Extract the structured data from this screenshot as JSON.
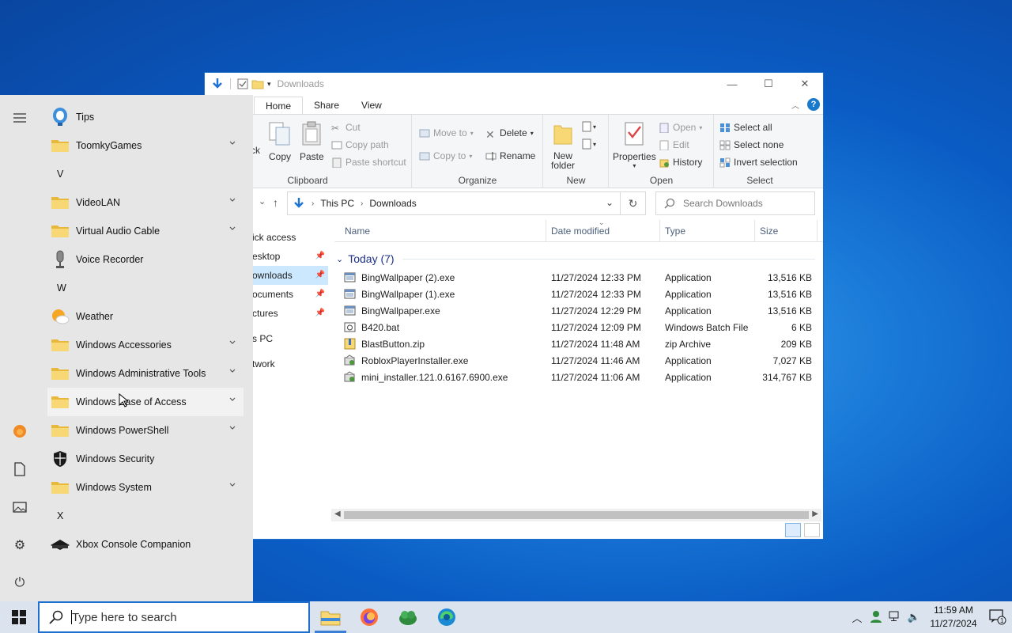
{
  "explorer": {
    "title": "Downloads",
    "tabs": [
      "Home",
      "Share",
      "View"
    ],
    "ribbon": {
      "clipboard": {
        "label": "Clipboard",
        "back_fragment": "ck",
        "copy": "Copy",
        "paste": "Paste",
        "cut": "Cut",
        "copy_path": "Copy path",
        "paste_shortcut": "Paste shortcut"
      },
      "organize": {
        "label": "Organize",
        "move_to": "Move to",
        "copy_to": "Copy to",
        "delete": "Delete",
        "rename": "Rename"
      },
      "new": {
        "label": "New",
        "new_folder": "New folder"
      },
      "open": {
        "label": "Open",
        "properties": "Properties",
        "open": "Open",
        "edit": "Edit",
        "history": "History"
      },
      "select": {
        "label": "Select",
        "select_all": "Select all",
        "select_none": "Select none",
        "invert_selection": "Invert selection"
      }
    },
    "address": {
      "crumbs": [
        "This PC",
        "Downloads"
      ],
      "search_placeholder": "Search Downloads"
    },
    "nav": [
      {
        "label": "ick access",
        "pinned": false
      },
      {
        "label": "esktop",
        "pinned": true
      },
      {
        "label": "ownloads",
        "pinned": true
      },
      {
        "label": "ocuments",
        "pinned": true
      },
      {
        "label": "ctures",
        "pinned": true
      },
      {
        "label": "s PC",
        "pinned": false
      },
      {
        "label": "twork",
        "pinned": false
      }
    ],
    "columns": {
      "name": "Name",
      "date": "Date modified",
      "type": "Type",
      "size": "Size"
    },
    "group": "Today (7)",
    "files": [
      {
        "name": "BingWallpaper (2).exe",
        "date": "11/27/2024 12:33 PM",
        "type": "Application",
        "size": "13,516 KB",
        "icon": "exe-icon"
      },
      {
        "name": "BingWallpaper (1).exe",
        "date": "11/27/2024 12:33 PM",
        "type": "Application",
        "size": "13,516 KB",
        "icon": "exe-icon"
      },
      {
        "name": "BingWallpaper.exe",
        "date": "11/27/2024 12:29 PM",
        "type": "Application",
        "size": "13,516 KB",
        "icon": "exe-icon"
      },
      {
        "name": "B420.bat",
        "date": "11/27/2024 12:09 PM",
        "type": "Windows Batch File",
        "size": "6 KB",
        "icon": "bat-icon"
      },
      {
        "name": "BlastButton.zip",
        "date": "11/27/2024 11:48 AM",
        "type": "zip Archive",
        "size": "209 KB",
        "icon": "zip-icon"
      },
      {
        "name": "RobloxPlayerInstaller.exe",
        "date": "11/27/2024 11:46 AM",
        "type": "Application",
        "size": "7,027 KB",
        "icon": "installer-icon"
      },
      {
        "name": "mini_installer.121.0.6167.6900.exe",
        "date": "11/27/2024 11:06 AM",
        "type": "Application",
        "size": "314,767 KB",
        "icon": "installer-icon"
      }
    ]
  },
  "startmenu": {
    "items": [
      {
        "kind": "app",
        "label": "Tips",
        "icon": "tips-icon"
      },
      {
        "kind": "folder",
        "label": "ToomkyGames"
      },
      {
        "kind": "letter",
        "label": "V"
      },
      {
        "kind": "folder",
        "label": "VideoLAN"
      },
      {
        "kind": "folder",
        "label": "Virtual Audio Cable"
      },
      {
        "kind": "app",
        "label": "Voice Recorder",
        "icon": "microphone-icon"
      },
      {
        "kind": "letter",
        "label": "W"
      },
      {
        "kind": "app",
        "label": "Weather",
        "icon": "weather-icon"
      },
      {
        "kind": "folder",
        "label": "Windows Accessories"
      },
      {
        "kind": "folder",
        "label": "Windows Administrative Tools"
      },
      {
        "kind": "folder",
        "label": "Windows Ease of Access",
        "hover": true
      },
      {
        "kind": "folder",
        "label": "Windows PowerShell"
      },
      {
        "kind": "app",
        "label": "Windows Security",
        "icon": "shield-icon"
      },
      {
        "kind": "folder",
        "label": "Windows System"
      },
      {
        "kind": "letter",
        "label": "X"
      },
      {
        "kind": "app",
        "label": "Xbox Console Companion",
        "icon": "xbox-icon"
      }
    ]
  },
  "taskbar": {
    "search_placeholder": "Type here to search",
    "time": "11:59 AM",
    "date": "11/27/2024",
    "notification_count": "1"
  },
  "colors": {
    "accent": "#0078d7",
    "folder": "#f8d775"
  }
}
